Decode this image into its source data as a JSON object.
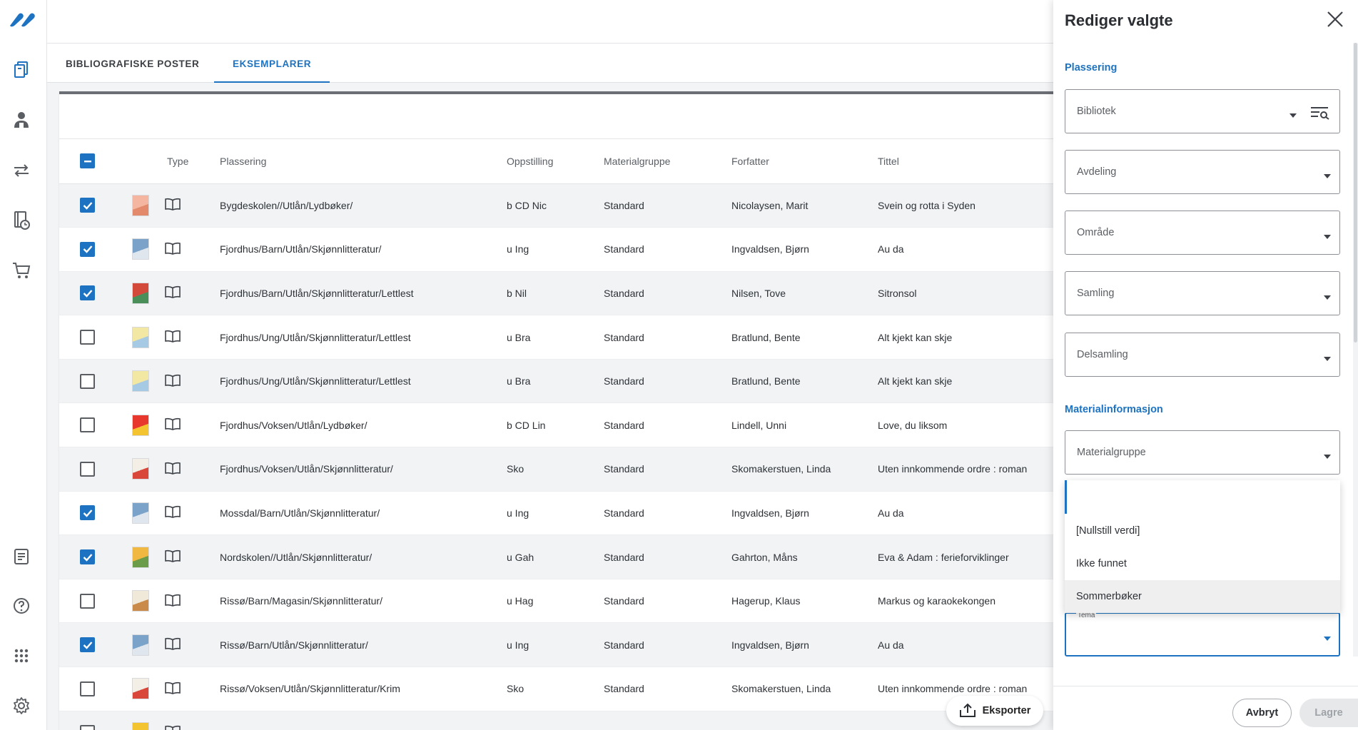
{
  "app": {
    "logo": "logo-icon"
  },
  "nav": {
    "top_items": [
      {
        "name": "books-icon"
      },
      {
        "name": "patron-icon"
      },
      {
        "name": "transfer-icon"
      },
      {
        "name": "due-icon"
      },
      {
        "name": "cart-icon"
      }
    ],
    "bottom_items": [
      {
        "name": "report-icon"
      },
      {
        "name": "help-icon"
      },
      {
        "name": "apps-icon"
      },
      {
        "name": "settings-icon"
      }
    ]
  },
  "tabs": [
    {
      "label": "BIBLIOGRAFISKE POSTER",
      "active": false
    },
    {
      "label": "EKSEMPLARER",
      "active": true
    }
  ],
  "table": {
    "columns": [
      "Type",
      "Plassering",
      "Oppstilling",
      "Materialgruppe",
      "Forfatter",
      "Tittel"
    ],
    "rows": [
      {
        "checked": true,
        "plassering": "Bygdeskolen//Utlån/Lydbøker/",
        "oppstilling": "b CD Nic",
        "materialgruppe": "Standard",
        "forfatter": "Nicolaysen, Marit",
        "tittel": "Svein og rotta i Syden"
      },
      {
        "checked": true,
        "plassering": "Fjordhus/Barn/Utlån/Skjønnlitteratur/",
        "oppstilling": "u Ing",
        "materialgruppe": "Standard",
        "forfatter": "Ingvaldsen, Bjørn",
        "tittel": "Au da"
      },
      {
        "checked": true,
        "plassering": "Fjordhus/Barn/Utlån/Skjønnlitteratur/Lettlest",
        "oppstilling": "b Nil",
        "materialgruppe": "Standard",
        "forfatter": "Nilsen, Tove",
        "tittel": "Sitronsol"
      },
      {
        "checked": false,
        "plassering": "Fjordhus/Ung/Utlån/Skjønnlitteratur/Lettlest",
        "oppstilling": "u Bra",
        "materialgruppe": "Standard",
        "forfatter": "Bratlund, Bente",
        "tittel": "Alt kjekt kan skje"
      },
      {
        "checked": false,
        "plassering": "Fjordhus/Ung/Utlån/Skjønnlitteratur/Lettlest",
        "oppstilling": "u Bra",
        "materialgruppe": "Standard",
        "forfatter": "Bratlund, Bente",
        "tittel": "Alt kjekt kan skje"
      },
      {
        "checked": false,
        "plassering": "Fjordhus/Voksen/Utlån/Lydbøker/",
        "oppstilling": "b CD Lin",
        "materialgruppe": "Standard",
        "forfatter": "Lindell, Unni",
        "tittel": "Love, du liksom"
      },
      {
        "checked": false,
        "plassering": "Fjordhus/Voksen/Utlån/Skjønnlitteratur/",
        "oppstilling": "Sko",
        "materialgruppe": "Standard",
        "forfatter": "Skomakerstuen, Linda",
        "tittel": "Uten innkommende ordre : roman"
      },
      {
        "checked": true,
        "plassering": "Mossdal/Barn/Utlån/Skjønnlitteratur/",
        "oppstilling": "u Ing",
        "materialgruppe": "Standard",
        "forfatter": "Ingvaldsen, Bjørn",
        "tittel": "Au da"
      },
      {
        "checked": true,
        "plassering": "Nordskolen//Utlån/Skjønnlitteratur/",
        "oppstilling": "u Gah",
        "materialgruppe": "Standard",
        "forfatter": "Gahrton, Måns",
        "tittel": "Eva & Adam : ferieforviklinger"
      },
      {
        "checked": false,
        "plassering": "Rissø/Barn/Magasin/Skjønnlitteratur/",
        "oppstilling": "u Hag",
        "materialgruppe": "Standard",
        "forfatter": "Hagerup, Klaus",
        "tittel": "Markus og karaokekongen"
      },
      {
        "checked": true,
        "plassering": "Rissø/Barn/Utlån/Skjønnlitteratur/",
        "oppstilling": "u Ing",
        "materialgruppe": "Standard",
        "forfatter": "Ingvaldsen, Bjørn",
        "tittel": "Au da"
      },
      {
        "checked": false,
        "plassering": "Rissø/Voksen/Utlån/Skjønnlitteratur/Krim",
        "oppstilling": "Sko",
        "materialgruppe": "Standard",
        "forfatter": "Skomakerstuen, Linda",
        "tittel": "Uten innkommende ordre : roman"
      },
      {
        "checked": false,
        "plassering": "",
        "oppstilling": "",
        "materialgruppe": "",
        "forfatter": "",
        "tittel": ""
      }
    ]
  },
  "export_button": {
    "label": "Eksporter"
  },
  "panel": {
    "title": "Rediger valgte",
    "section_location": "Plassering",
    "fields_location": [
      "Bibliotek",
      "Avdeling",
      "Område",
      "Samling",
      "Delsamling"
    ],
    "section_material": "Materialinformasjon",
    "field_materialgruppe": "Materialgruppe",
    "field_tema": "Tema",
    "dropdown_options": [
      "[Nullstill verdi]",
      "Ikke funnet",
      "Sommerbøker"
    ],
    "cancel_label": "Avbryt",
    "save_label": "Lagre"
  },
  "colors": {
    "accent": "#1d73c2",
    "text": "#2d3136",
    "muted": "#5a5e63"
  }
}
